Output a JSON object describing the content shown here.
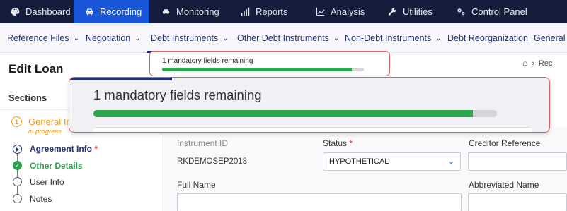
{
  "topnav": [
    {
      "label": "Dashboard",
      "icon": "palette-icon"
    },
    {
      "label": "Recording",
      "icon": "car-icon",
      "active": true
    },
    {
      "label": "Monitoring",
      "icon": "binoculars-icon"
    },
    {
      "label": "Reports",
      "icon": "bar-chart-icon"
    },
    {
      "label": "Analysis",
      "icon": "line-chart-icon"
    },
    {
      "label": "Utilities",
      "icon": "wrench-icon"
    },
    {
      "label": "Control Panel",
      "icon": "cogs-icon"
    }
  ],
  "subnav": [
    {
      "label": "Reference Files",
      "chevron": "⌄"
    },
    {
      "label": "Negotiation",
      "chevron": "⌄"
    },
    {
      "label": "Debt Instruments",
      "chevron": "⌄",
      "active": true
    },
    {
      "label": "Other Debt Instruments",
      "chevron": "⌄"
    },
    {
      "label": "Non-Debt Instruments",
      "chevron": "⌄"
    },
    {
      "label": "Debt Reorganization",
      "chevron": ""
    },
    {
      "label": "General",
      "chevron": ""
    }
  ],
  "page": {
    "title": "Edit Loan",
    "breadcrumb": "Rec"
  },
  "sections": {
    "label": "Sections",
    "general": {
      "number": "1",
      "title": "General In",
      "status": "in progress"
    },
    "steps": [
      {
        "label": "Agreement Info",
        "required_mark": "*",
        "state": "current"
      },
      {
        "label": "Other Details",
        "state": "done"
      },
      {
        "label": "User Info",
        "state": "todo"
      },
      {
        "label": "Notes",
        "state": "todo"
      }
    ]
  },
  "form": {
    "instrument_id_label": "Instrument ID",
    "instrument_id_value": "RKDEMOSEP2018",
    "status_label": "Status",
    "status_required": "*",
    "status_value": "HYPOTHETICAL",
    "creditor_reference_label": "Creditor Reference",
    "full_name_label": "Full Name",
    "abbreviated_name_label": "Abbreviated Name"
  },
  "progress": {
    "text": "1 mandatory fields remaining",
    "fraction": 0.94
  },
  "colors": {
    "topbar": "#141e3c",
    "active_tab": "#1a56d8",
    "accent_navy": "#23307a",
    "progress_green": "#2ea44f",
    "in_progress_orange": "#f39c12",
    "highlight_red": "#e35b5b"
  }
}
